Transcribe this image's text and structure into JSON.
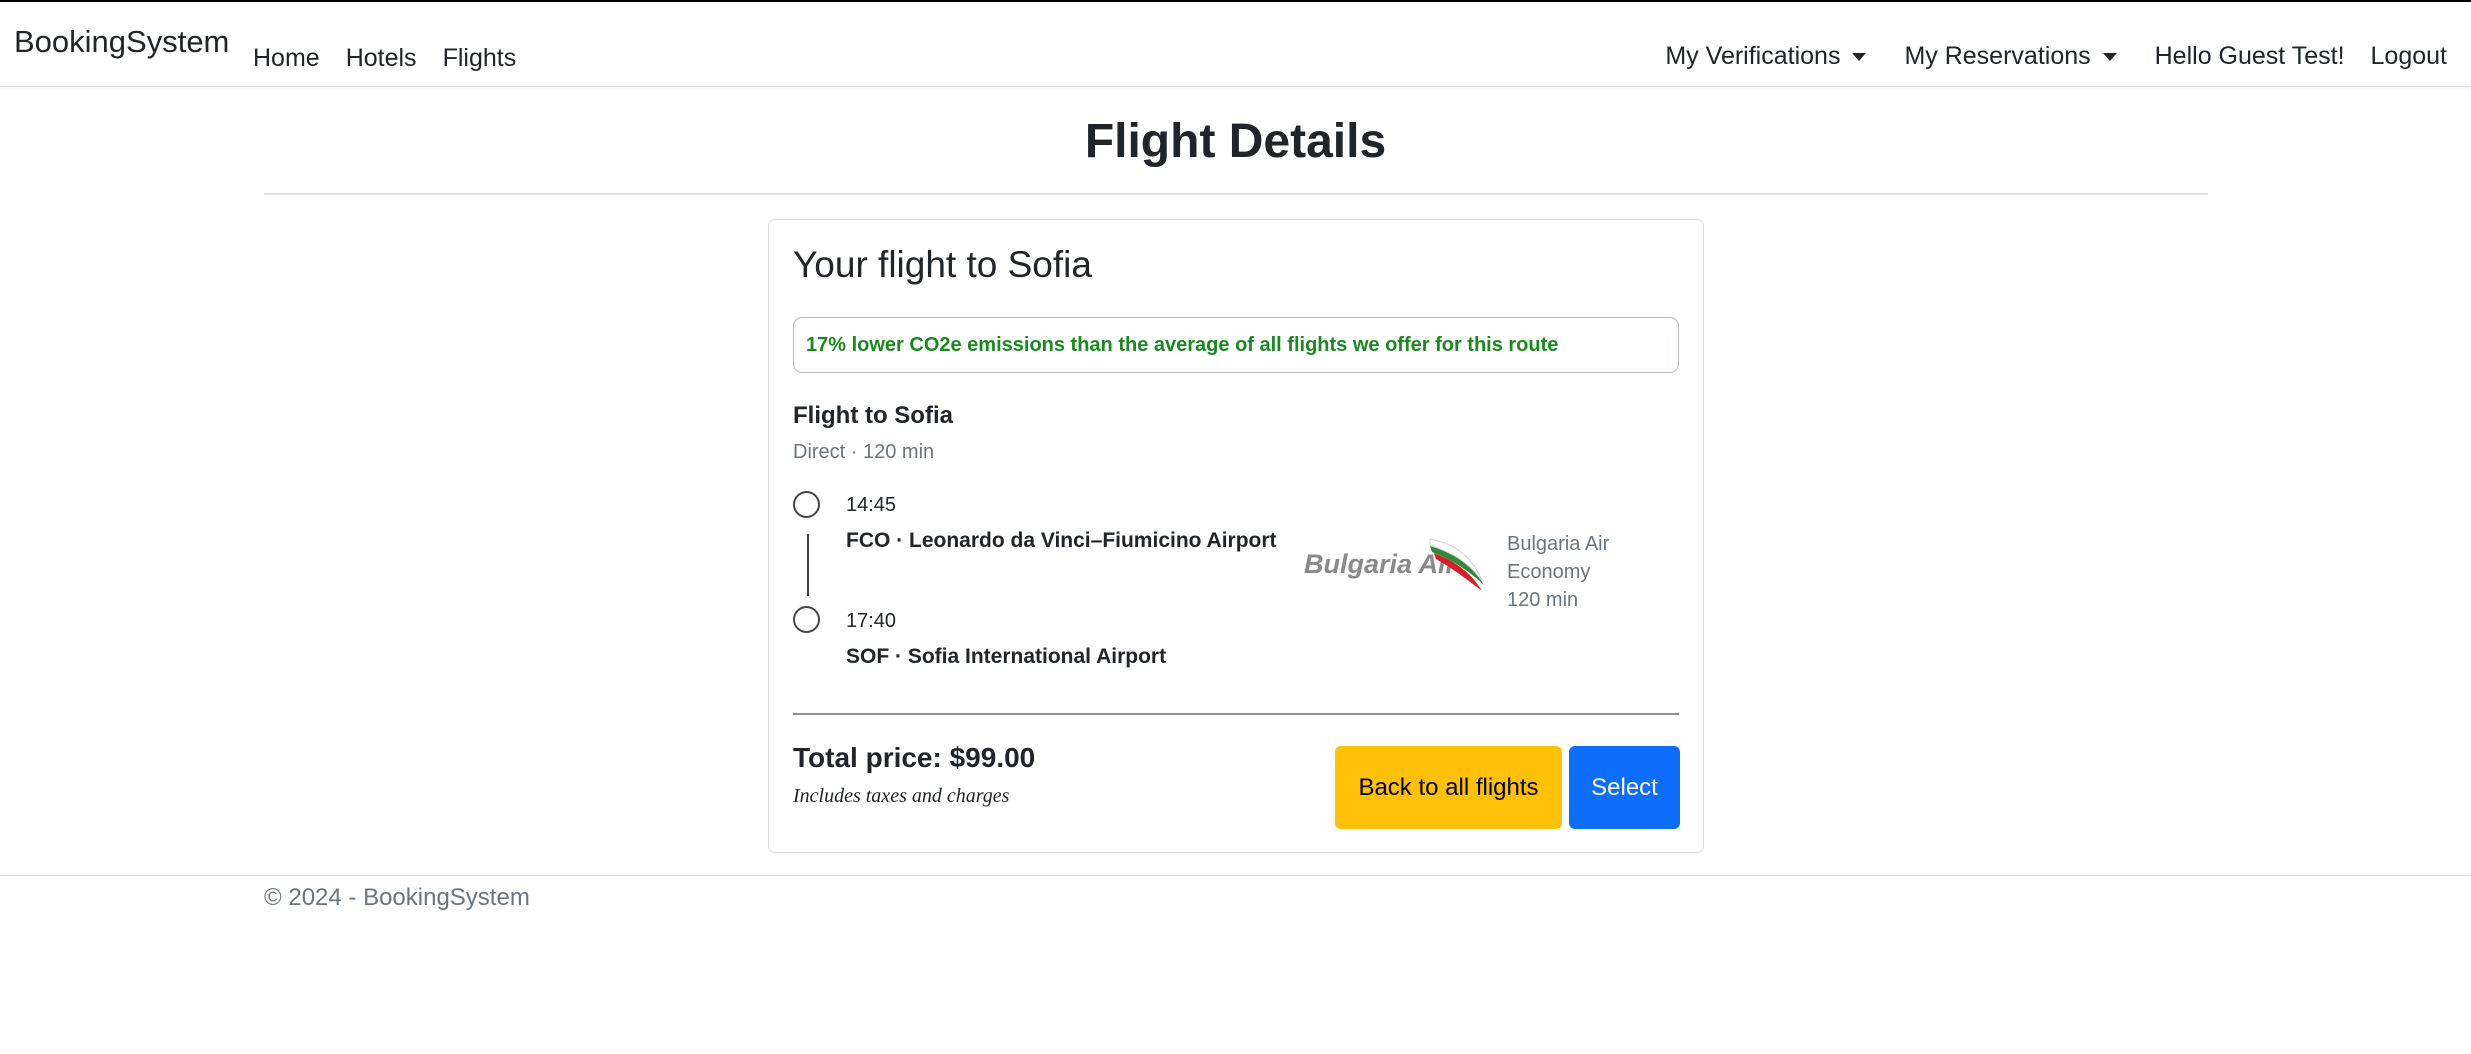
{
  "nav": {
    "brand": "BookingSystem",
    "links": [
      "Home",
      "Hotels",
      "Flights"
    ],
    "verifications": "My Verifications",
    "reservations": "My Reservations",
    "greeting": "Hello Guest Test!",
    "logout": "Logout"
  },
  "page": {
    "title": "Flight Details"
  },
  "card": {
    "title": "Your flight to Sofia",
    "eco": "17% lower CO2e emissions than the average of all flights we offer for this route",
    "segment_title": "Flight to Sofia",
    "segment_sub": "Direct · 120 min",
    "departure": {
      "time": "14:45",
      "airport": "FCO · Leonardo da Vinci–Fiumicino Airport"
    },
    "arrival": {
      "time": "17:40",
      "airport": "SOF · Sofia International Airport"
    },
    "airline": {
      "logo_text": "Bulgaria Air",
      "name": "Bulgaria Air",
      "cabin": "Economy",
      "duration": "120 min"
    },
    "total_price": "Total price: $99.00",
    "price_note": "Includes taxes and charges",
    "back_button": "Back to all flights",
    "select_button": "Select"
  },
  "footer": {
    "text": "© 2024 - BookingSystem"
  },
  "colors": {
    "eco_text": "#198a1f",
    "back_button": "#ffc107",
    "select_button": "#0d6efd"
  },
  "icons": {
    "dropdown": "caret-down-icon",
    "timeline": "circle-icon"
  }
}
